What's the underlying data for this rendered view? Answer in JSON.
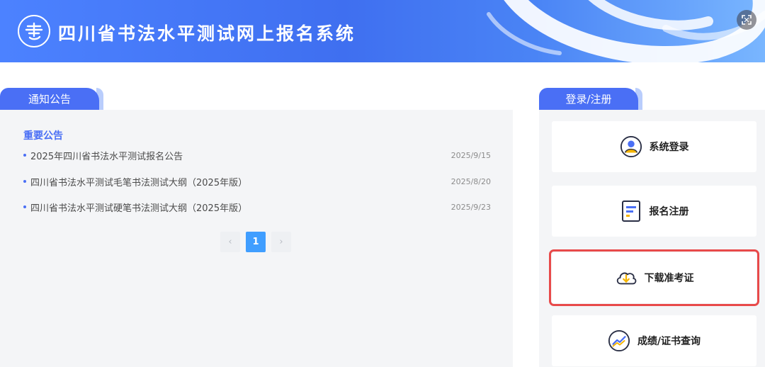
{
  "header": {
    "logo_char": "書",
    "title": "四川省书法水平测试网上报名系统"
  },
  "notice": {
    "tab_label": "通知公告",
    "heading": "重要公告",
    "items": [
      {
        "title": "2025年四川省书法水平测试报名公告",
        "date": "2025/9/15"
      },
      {
        "title": "四川省书法水平测试毛笔书法测试大纲（2025年版）",
        "date": "2025/8/20"
      },
      {
        "title": "四川省书法水平测试硬笔书法测试大纲（2025年版）",
        "date": "2025/9/23"
      }
    ],
    "pagination": {
      "prev": "‹",
      "current": "1",
      "next": "›"
    }
  },
  "login": {
    "tab_label": "登录/注册",
    "actions": [
      {
        "label": "系统登录",
        "icon": "user-login-icon"
      },
      {
        "label": "报名注册",
        "icon": "registration-form-icon"
      },
      {
        "label": "下载准考证",
        "icon": "cloud-download-icon"
      },
      {
        "label": "成绩/证书查询",
        "icon": "chart-query-icon"
      }
    ]
  },
  "colors": {
    "primary": "#4a6ff5",
    "highlight": "#e84a4a",
    "pagination_active": "#409eff"
  }
}
